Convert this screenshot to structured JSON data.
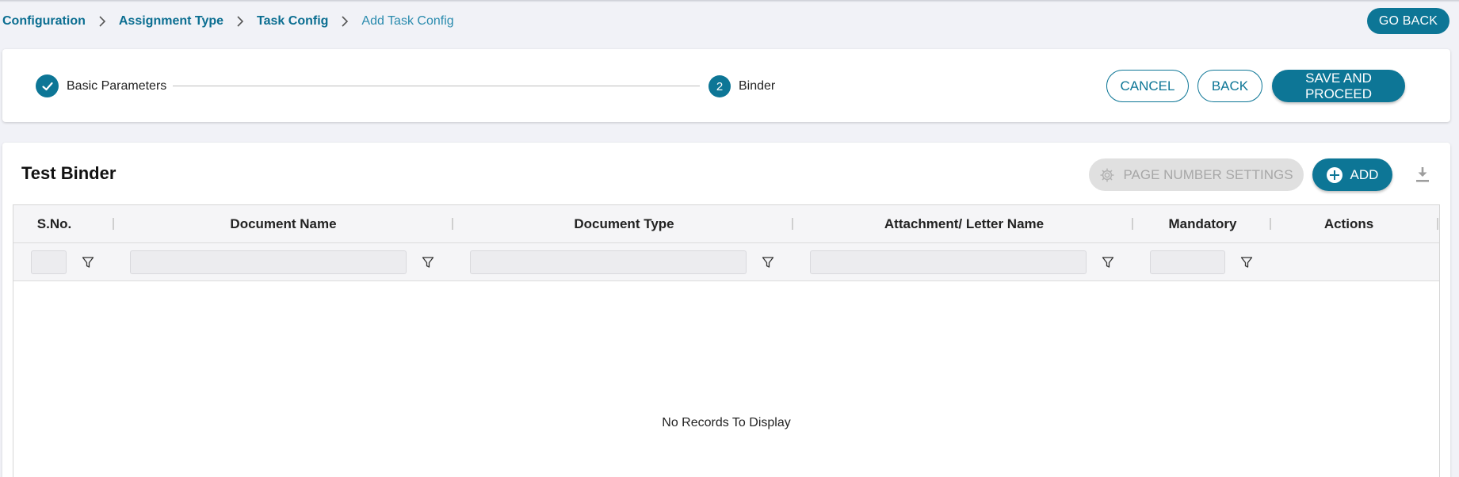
{
  "breadcrumb": [
    {
      "label": "Configuration"
    },
    {
      "label": "Assignment Type"
    },
    {
      "label": "Task Config"
    },
    {
      "label": "Add Task Config"
    }
  ],
  "header": {
    "go_back": "GO BACK"
  },
  "stepper": {
    "steps": [
      {
        "label": "Basic Parameters",
        "status": "completed"
      },
      {
        "number": "2",
        "label": "Binder",
        "status": "active"
      }
    ],
    "cancel": "CANCEL",
    "back": "BACK",
    "save": "SAVE AND PROCEED"
  },
  "binder": {
    "title": "Test Binder",
    "page_number_settings": "PAGE NUMBER SETTINGS",
    "add": "ADD",
    "columns": [
      {
        "label": "S.No."
      },
      {
        "label": "Document Name"
      },
      {
        "label": "Document Type"
      },
      {
        "label": "Attachment/ Letter Name"
      },
      {
        "label": "Mandatory"
      },
      {
        "label": "Actions"
      }
    ],
    "rows": [],
    "empty_message": "No Records To Display"
  },
  "colors": {
    "primary": "#0d7696",
    "breadcrumb_link": "#0b6e91",
    "disabled_bg": "#e0e0e0",
    "disabled_text": "#a7a7a7",
    "page_bg": "#f1f2f7"
  },
  "icons": {
    "breadcrumb_separator": "chevron-right-icon",
    "step_done": "check-icon",
    "page_settings": "gear-icon",
    "add": "plus-circle-icon",
    "download": "download-icon",
    "filter": "filter-icon"
  }
}
